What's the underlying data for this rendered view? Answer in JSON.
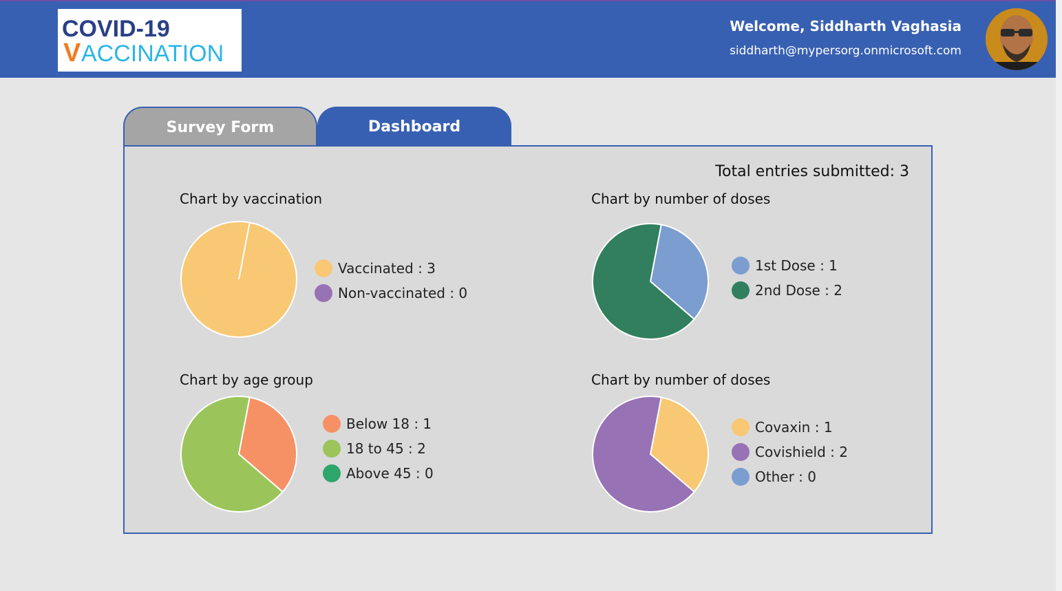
{
  "app": {
    "logo_line1": "COVID-19",
    "logo_line2": "ACCINATION",
    "logo_check": "V"
  },
  "header": {
    "welcome": "Welcome, Siddharth Vaghasia",
    "email": "siddharth@mypersorg.onmicrosoft.com"
  },
  "tabs": [
    {
      "label": "Survey Form",
      "active": false
    },
    {
      "label": "Dashboard",
      "active": true
    }
  ],
  "dashboard": {
    "total_label": "Total entries submitted: 3"
  },
  "colors": {
    "brand": "#3860b2",
    "yellow": "#f8c874",
    "purple": "#9772b5",
    "blue": "#7b9dd0",
    "dark_green": "#317f5e",
    "salmon": "#f69166",
    "light_green": "#9bc55a",
    "green": "#2ea56a"
  },
  "chart_data": [
    {
      "type": "pie",
      "title": "Chart by vaccination",
      "categories": [
        "Vaccinated",
        "Non-vaccinated"
      ],
      "values": [
        3,
        0
      ],
      "colors": [
        "#f8c874",
        "#9772b5"
      ],
      "legend": [
        "Vaccinated : 3",
        "Non-vaccinated : 0"
      ]
    },
    {
      "type": "pie",
      "title": "Chart by number of doses",
      "categories": [
        "1st Dose",
        "2nd Dose"
      ],
      "values": [
        1,
        2
      ],
      "colors": [
        "#7b9dd0",
        "#317f5e"
      ],
      "legend": [
        "1st Dose : 1",
        "2nd Dose : 2"
      ]
    },
    {
      "type": "pie",
      "title": "Chart by age group",
      "categories": [
        "Below 18",
        "18 to 45",
        "Above 45"
      ],
      "values": [
        1,
        2,
        0
      ],
      "colors": [
        "#f69166",
        "#9bc55a",
        "#2ea56a"
      ],
      "legend": [
        "Below 18 : 1",
        "18 to 45 : 2",
        "Above 45 : 0"
      ]
    },
    {
      "type": "pie",
      "title": "Chart by number of doses",
      "categories": [
        "Covaxin",
        "Covishield",
        "Other"
      ],
      "values": [
        1,
        2,
        0
      ],
      "colors": [
        "#f8c874",
        "#9772b5",
        "#7b9dd0"
      ],
      "legend": [
        "Covaxin : 1",
        "Covishield : 2",
        "Other : 0"
      ]
    }
  ]
}
